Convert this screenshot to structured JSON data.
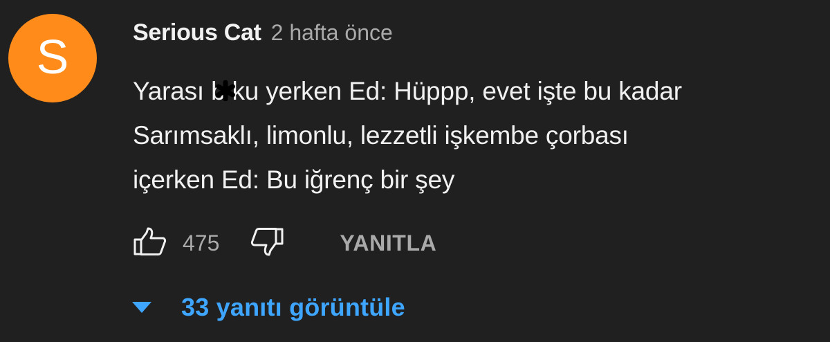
{
  "comment": {
    "avatar": {
      "letter": "S",
      "color": "#ff8c1a"
    },
    "author": "Serious Cat",
    "timestamp": "2 hafta önce",
    "lines": {
      "line1_before": "Yarası b",
      "line1_after": "ku yerken Ed: Hüppp, evet işte bu kadar",
      "line2": "Sarımsaklı, limonlu, lezzetli işkembe çorbası",
      "line3": "içerken Ed: Bu iğrenç bir şey"
    },
    "censor_icon": "asterisk-censor-icon",
    "actions": {
      "like_icon": "thumbs-up-icon",
      "like_count": "475",
      "dislike_icon": "thumbs-down-icon",
      "reply_label": "YANITLA"
    },
    "replies": {
      "arrow_icon": "caret-down-icon",
      "label": "33 yanıtı görüntüle",
      "color": "#3ea6ff"
    }
  }
}
